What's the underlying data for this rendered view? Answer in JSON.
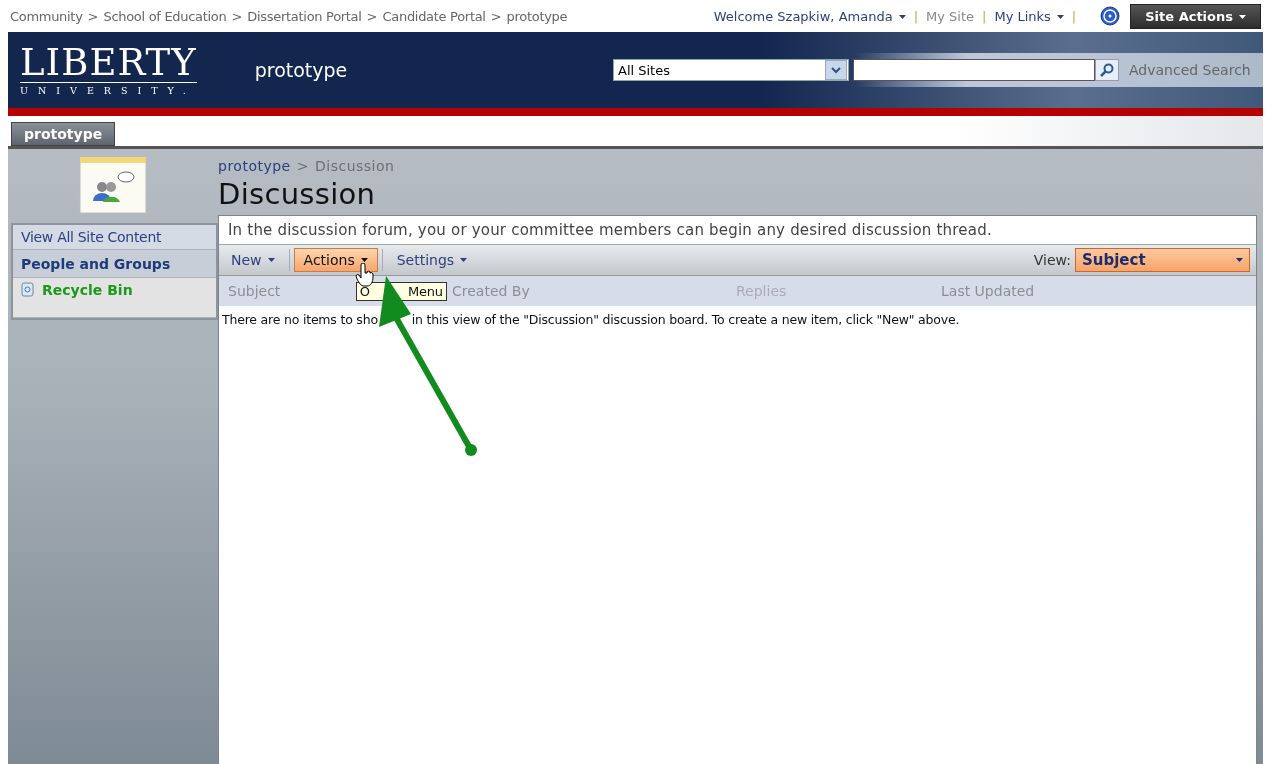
{
  "breadcrumb_separator": ">",
  "link_separator": "|",
  "breadcrumb": [
    "Community",
    "School of Education",
    "Dissertation Portal",
    "Candidate Portal",
    "prototype"
  ],
  "user_links": [
    {
      "label": "Welcome Szapkiw, Amanda",
      "menu": true
    },
    {
      "label": "My Site",
      "menu": false
    },
    {
      "label": "My Links",
      "menu": true
    }
  ],
  "site_actions": "Site Actions",
  "header": {
    "logo_main": "LIBERTY",
    "logo_sub": "UNIVERSITY.",
    "site_title": "prototype",
    "scope": "All Sites",
    "advanced_search": "Advanced Search"
  },
  "tabs": [
    {
      "label": "prototype",
      "selected": true
    }
  ],
  "sidebar": {
    "items": [
      {
        "label": "View All Site Content",
        "kind": "link"
      },
      {
        "label": "People and Groups",
        "kind": "heading"
      },
      {
        "label": "Recycle Bin",
        "kind": "bin"
      }
    ]
  },
  "page": {
    "breadcrumb_separator": ">",
    "breadcrumb": [
      "prototype",
      "Discussion"
    ],
    "title": "Discussion",
    "description": "In the discussion forum, you  or your committee members can begin any desired discussion thread."
  },
  "toolbar": {
    "menus": [
      {
        "label": "New",
        "selected": false
      },
      {
        "label": "Actions",
        "selected": true
      },
      {
        "label": "Settings",
        "selected": false
      }
    ],
    "view_label": "View:",
    "view": "Subject"
  },
  "tooltip": [
    "O",
    "Menu"
  ],
  "table": {
    "columns": [
      "Subject",
      "Created By",
      "Replies",
      "Last Updated"
    ],
    "empty_message": [
      "There are no items to sho",
      "in this view of the \"Discussion\" discussion board. To create a new item, click \"New\" above."
    ]
  }
}
